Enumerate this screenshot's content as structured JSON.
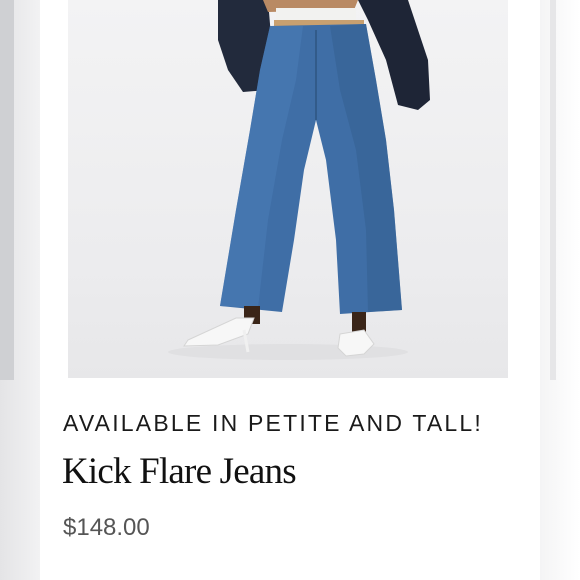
{
  "product": {
    "promo_text": "AVAILABLE IN PETITE AND TALL!",
    "name": "Kick Flare Jeans",
    "price": "$148.00"
  },
  "colors": {
    "denim": "#3f6ea6",
    "jacket": "#1e2536",
    "text_primary": "#111111",
    "text_price": "#555555"
  }
}
